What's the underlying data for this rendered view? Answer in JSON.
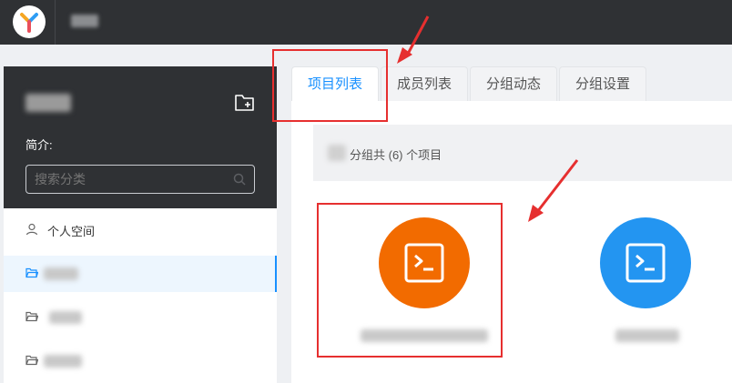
{
  "sidebar": {
    "intro_label": "简介:",
    "search_placeholder": "搜索分类",
    "items": [
      {
        "label": "个人空间",
        "icon": "user-icon"
      },
      {
        "label": "",
        "icon": "folder-open-icon",
        "active": true
      },
      {
        "label": "",
        "icon": "folder-icon"
      },
      {
        "label": "",
        "icon": "folder-icon"
      }
    ]
  },
  "tabs": [
    {
      "label": "项目列表",
      "active": true
    },
    {
      "label": "成员列表"
    },
    {
      "label": "分组动态"
    },
    {
      "label": "分组设置"
    }
  ],
  "summary": {
    "text": "分组共 (6) 个项目"
  },
  "projects": [
    {
      "name": "",
      "color": "#f26b00",
      "icon": "terminal-icon"
    },
    {
      "name": "",
      "color": "#2395f1",
      "icon": "terminal-icon"
    }
  ],
  "colors": {
    "accent": "#1890ff",
    "topbar": "#2f3134",
    "annotation": "#e62f2f"
  }
}
